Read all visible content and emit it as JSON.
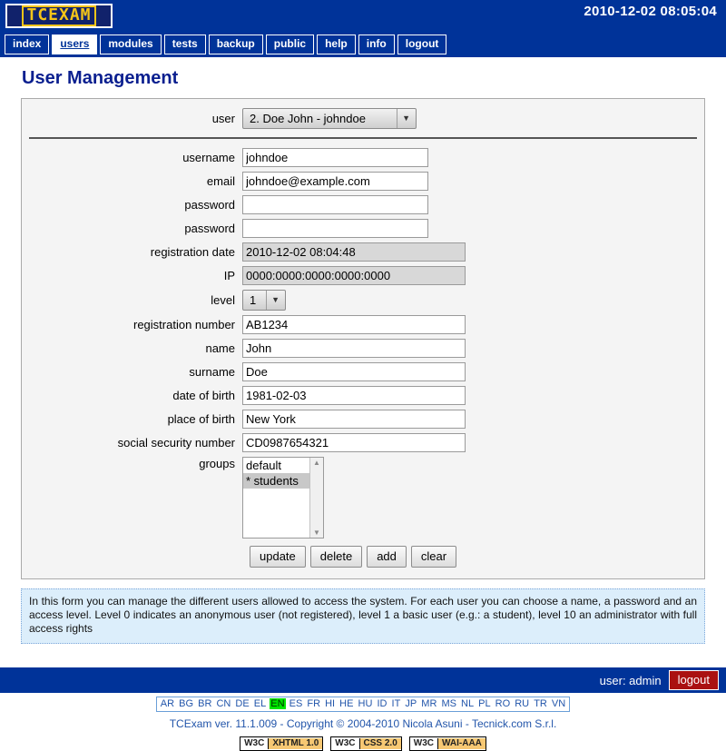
{
  "header": {
    "logo_text": "TCEXAM",
    "datetime": "2010-12-02 08:05:04"
  },
  "nav": {
    "items": [
      {
        "label": "index",
        "active": false
      },
      {
        "label": "users",
        "active": true
      },
      {
        "label": "modules",
        "active": false
      },
      {
        "label": "tests",
        "active": false
      },
      {
        "label": "backup",
        "active": false
      },
      {
        "label": "public",
        "active": false
      },
      {
        "label": "help",
        "active": false
      },
      {
        "label": "info",
        "active": false
      },
      {
        "label": "logout",
        "active": false
      }
    ]
  },
  "page": {
    "title": "User Management"
  },
  "form": {
    "user_select": {
      "label": "user",
      "value": "2. Doe John - johndoe",
      "arrow": "▼"
    },
    "fields": [
      {
        "label": "username",
        "value": "johndoe",
        "type": "text",
        "disabled": false
      },
      {
        "label": "email",
        "value": "johndoe@example.com",
        "type": "text",
        "disabled": false
      },
      {
        "label": "password",
        "value": "",
        "type": "password",
        "disabled": false
      },
      {
        "label": "password",
        "value": "",
        "type": "password",
        "disabled": false
      },
      {
        "label": "registration date",
        "value": "2010-12-02 08:04:48",
        "type": "text",
        "disabled": true
      },
      {
        "label": "IP",
        "value": "0000:0000:0000:0000:0000",
        "type": "text",
        "disabled": true
      }
    ],
    "level_select": {
      "label": "level",
      "value": "1",
      "arrow": "▼"
    },
    "fields2": [
      {
        "label": "registration number",
        "value": "AB1234",
        "type": "text",
        "disabled": false
      },
      {
        "label": "name",
        "value": "John",
        "type": "text",
        "disabled": false
      },
      {
        "label": "surname",
        "value": "Doe",
        "type": "text",
        "disabled": false
      },
      {
        "label": "date of birth",
        "value": "1981-02-03",
        "type": "text",
        "disabled": false
      },
      {
        "label": "place of birth",
        "value": "New York",
        "type": "text",
        "disabled": false
      },
      {
        "label": "social security number",
        "value": "CD0987654321",
        "type": "text",
        "disabled": false
      }
    ],
    "groups": {
      "label": "groups",
      "options": [
        {
          "label": "default",
          "selected": false
        },
        {
          "label": "* students",
          "selected": true
        }
      ],
      "scroll_up": "▲",
      "scroll_down": "▼"
    },
    "buttons": [
      {
        "label": "update"
      },
      {
        "label": "delete"
      },
      {
        "label": "add"
      },
      {
        "label": "clear"
      }
    ]
  },
  "help": {
    "text": "In this form you can manage the different users allowed to access the system. For each user you can choose a name, a password and an access level. Level 0 indicates an anonymous user (not registered), level 1 a basic user (e.g.: a student), level 10 an administrator with full access rights"
  },
  "bottombar": {
    "user_text": "user: admin",
    "logout_label": "logout"
  },
  "footer": {
    "languages": [
      {
        "code": "AR",
        "current": false
      },
      {
        "code": "BG",
        "current": false
      },
      {
        "code": "BR",
        "current": false
      },
      {
        "code": "CN",
        "current": false
      },
      {
        "code": "DE",
        "current": false
      },
      {
        "code": "EL",
        "current": false
      },
      {
        "code": "EN",
        "current": true
      },
      {
        "code": "ES",
        "current": false
      },
      {
        "code": "FR",
        "current": false
      },
      {
        "code": "HI",
        "current": false
      },
      {
        "code": "HE",
        "current": false
      },
      {
        "code": "HU",
        "current": false
      },
      {
        "code": "ID",
        "current": false
      },
      {
        "code": "IT",
        "current": false
      },
      {
        "code": "JP",
        "current": false
      },
      {
        "code": "MR",
        "current": false
      },
      {
        "code": "MS",
        "current": false
      },
      {
        "code": "NL",
        "current": false
      },
      {
        "code": "PL",
        "current": false
      },
      {
        "code": "RO",
        "current": false
      },
      {
        "code": "RU",
        "current": false
      },
      {
        "code": "TR",
        "current": false
      },
      {
        "code": "VN",
        "current": false
      }
    ],
    "copyright": "TCExam ver. 11.1.009 - Copyright © 2004-2010 Nicola Asuni - Tecnick.com S.r.l.",
    "badges": [
      {
        "left": "W3C",
        "right": "XHTML 1.0"
      },
      {
        "left": "W3C",
        "right": "CSS 2.0"
      },
      {
        "left": "W3C",
        "right": "WAI-AAA"
      }
    ]
  },
  "colors": {
    "brand_blue": "#003399",
    "logo_yellow": "#f5c518",
    "title_blue": "#0a1f8f",
    "help_bg": "#dceefb",
    "logout_red": "#aa1111",
    "lang_current": "#00e600",
    "badge_orange": "#f7c873"
  }
}
